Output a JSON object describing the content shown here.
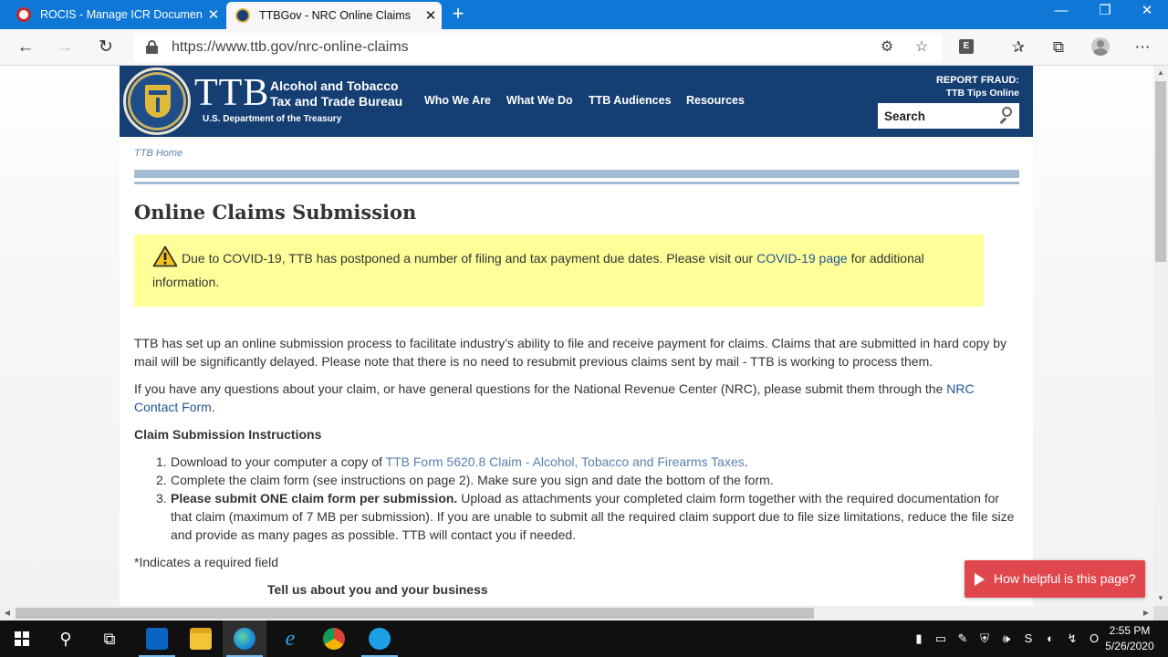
{
  "browser": {
    "tabs": [
      {
        "label": "ROCIS - Manage ICR Documents",
        "active": false
      },
      {
        "label": "TTBGov - NRC Online Claims",
        "active": true
      }
    ],
    "url": "https://www.ttb.gov/nrc-online-claims",
    "new_tab_symbol": "+",
    "close_symbol": "✕",
    "extension_badge": "E"
  },
  "header": {
    "logo_text": "TTB",
    "agency_line1": "Alcohol and Tobacco",
    "agency_line2": "Tax and Trade Bureau",
    "department": "U.S. Department of the Treasury",
    "nav": [
      "Who We Are",
      "What We Do",
      "TTB Audiences",
      "Resources"
    ],
    "report_line1": "REPORT FRAUD:",
    "report_line2": "TTB Tips Online",
    "search_placeholder": "Search"
  },
  "breadcrumb": "TTB Home",
  "page_title": "Online Claims Submission",
  "alert": {
    "text_before": "Due to COVID-19, TTB has postponed a number of filing and tax payment due dates. Please visit our ",
    "link": "COVID-19 page",
    "text_after": " for additional information."
  },
  "paragraphs": {
    "p1": "TTB has set up an online submission process to facilitate industry’s ability to file and receive payment for claims. Claims that are submitted in hard copy by mail will be significantly delayed. Please note that there is no need to resubmit previous claims sent by mail - TTB is working to process them.",
    "p2_before": "If you have any questions about your claim, or have general questions for the National Revenue Center (NRC), please submit them through the ",
    "p2_link": "NRC Contact Form",
    "p2_after": "."
  },
  "instructions": {
    "heading": "Claim Submission Instructions",
    "item1_before": "Download to your computer a copy of ",
    "item1_link": "TTB Form 5620.8 Claim - Alcohol, Tobacco and Firearms Taxes",
    "item1_after": ".",
    "item2": "Complete the claim form (see instructions on page 2).  Make sure you sign and date the bottom of the form.",
    "item3_bold": "Please submit ONE claim form per submission.",
    "item3_rest": " Upload as attachments your completed claim form together with the required documentation for that claim (maximum of 7 MB per submission). If you are unable to submit all the required claim support due to file size limitations, reduce the file size and provide as many pages as possible. TTB will contact you if needed."
  },
  "required_note": "*Indicates a required field",
  "form_section_title": "Tell us about you and your business",
  "feedback_button": "How helpful is this page?",
  "taskbar": {
    "time": "2:55 PM",
    "date": "5/26/2020"
  },
  "colors": {
    "header_bg": "#153f72",
    "alert_bg": "#ffff99",
    "link": "#1f5594",
    "feedback_bg": "#e0474c",
    "tabbar": "#0f78d7"
  }
}
